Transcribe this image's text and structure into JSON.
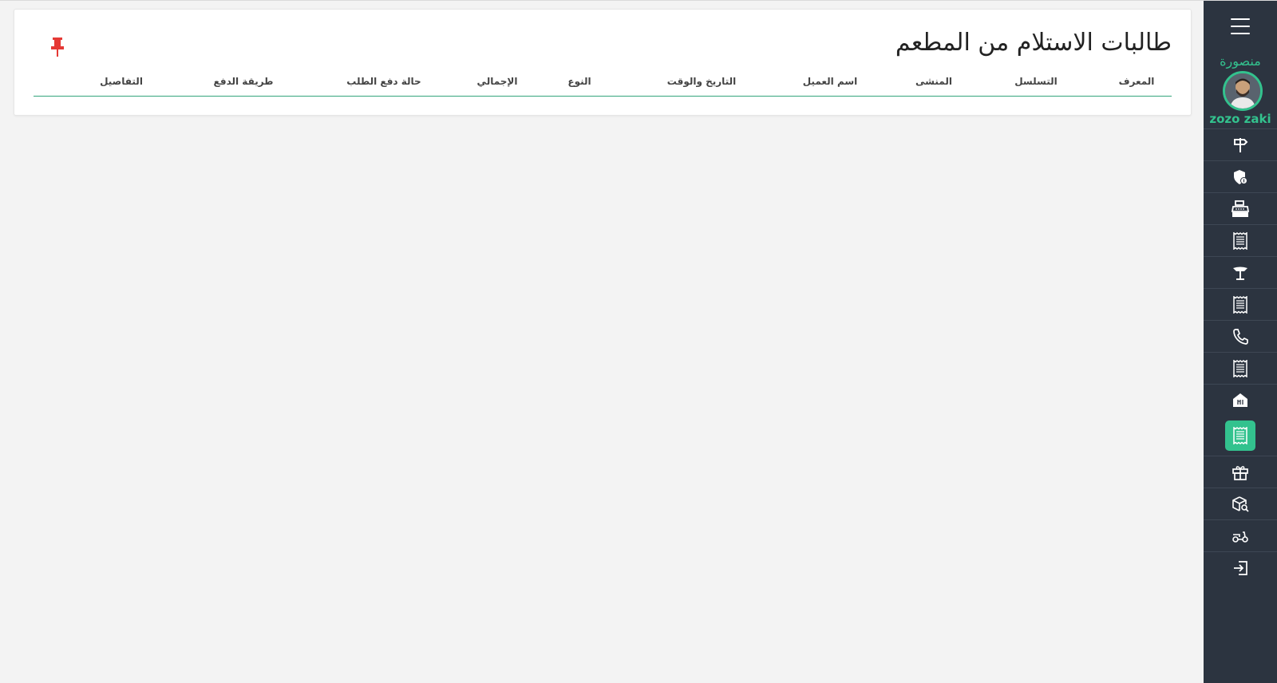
{
  "page": {
    "title": "طالبات الاستلام من المطعم"
  },
  "user": {
    "location": "منصورة",
    "name": "zozo zaki"
  },
  "table": {
    "columns": [
      "المعرف",
      "التسلسل",
      "المنشى",
      "اسم العميل",
      "التاريخ والوقت",
      "النوع",
      "الإجمالي",
      "حالة دفع الطلب",
      "طريقة الدفع",
      "التفاصيل"
    ]
  },
  "sidebar": {
    "icons": [
      "signpost-icon",
      "shield-dollar-icon",
      "cash-register-icon",
      "receipt-icon",
      "table-icon",
      "receipt-icon",
      "phone-icon",
      "receipt-icon",
      "shop-icon",
      "receipt-active-icon",
      "gift-icon",
      "box-search-icon",
      "scooter-icon",
      "logout-icon"
    ],
    "active_index": 9
  },
  "colors": {
    "sidebar_bg": "#2c3440",
    "accent": "#33c28e",
    "pin": "#e53935",
    "page_bg": "#f3f3f3"
  }
}
